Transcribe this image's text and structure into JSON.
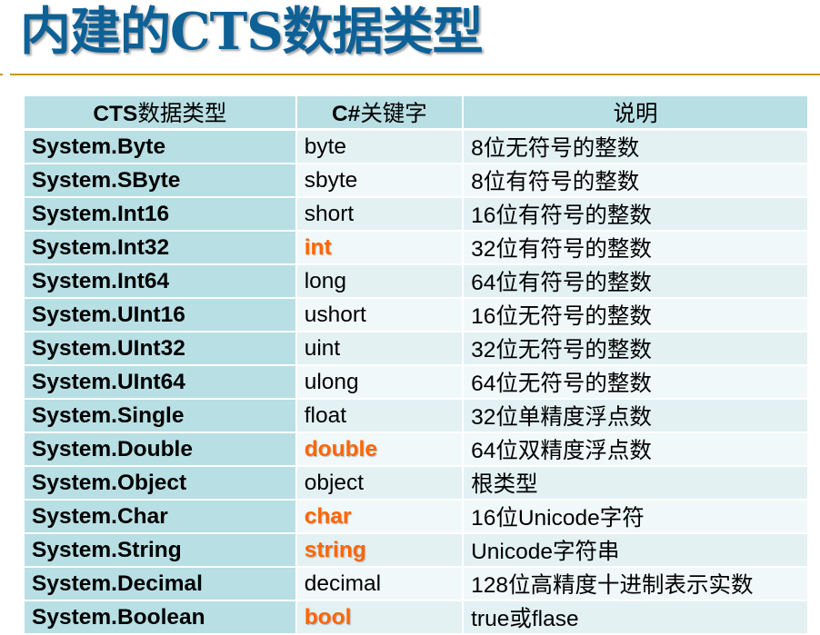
{
  "slide": {
    "title": "内建的CTS数据类型"
  },
  "table": {
    "headers": {
      "cts_latin": "CTS",
      "cts_cjk": "数据类型",
      "keyword_latin": "C#",
      "keyword_cjk": "关键字",
      "description": "说明"
    },
    "highlight_color": "#ff6600",
    "header_bg": "#b8dfe4",
    "rows": [
      {
        "cts": "System.Byte",
        "keyword": "byte",
        "description": "8位无符号的整数",
        "highlighted": false
      },
      {
        "cts": "System.SByte",
        "keyword": "sbyte",
        "description": "8位有符号的整数",
        "highlighted": false
      },
      {
        "cts": "System.Int16",
        "keyword": "short",
        "description": "16位有符号的整数",
        "highlighted": false
      },
      {
        "cts": "System.Int32",
        "keyword": "int",
        "description": "32位有符号的整数",
        "highlighted": true
      },
      {
        "cts": "System.Int64",
        "keyword": "long",
        "description": "64位有符号的整数",
        "highlighted": false
      },
      {
        "cts": "System.UInt16",
        "keyword": "ushort",
        "description": "16位无符号的整数",
        "highlighted": false
      },
      {
        "cts": "System.UInt32",
        "keyword": "uint",
        "description": "32位无符号的整数",
        "highlighted": false
      },
      {
        "cts": "System.UInt64",
        "keyword": "ulong",
        "description": "64位无符号的整数",
        "highlighted": false
      },
      {
        "cts": "System.Single",
        "keyword": "float",
        "description": "32位单精度浮点数",
        "highlighted": false
      },
      {
        "cts": "System.Double",
        "keyword": "double",
        "description": "64位双精度浮点数",
        "highlighted": true
      },
      {
        "cts": "System.Object",
        "keyword": "object",
        "description": "根类型",
        "highlighted": false
      },
      {
        "cts": "System.Char",
        "keyword": "char",
        "description": "16位Unicode字符",
        "highlighted": true
      },
      {
        "cts": "System.String",
        "keyword": "string",
        "description": "Unicode字符串",
        "highlighted": true
      },
      {
        "cts": "System.Decimal",
        "keyword": "decimal",
        "description": "128位高精度十进制表示实数",
        "highlighted": false
      },
      {
        "cts": "System.Boolean",
        "keyword": "bool",
        "description": "true或flase",
        "highlighted": true
      }
    ]
  }
}
